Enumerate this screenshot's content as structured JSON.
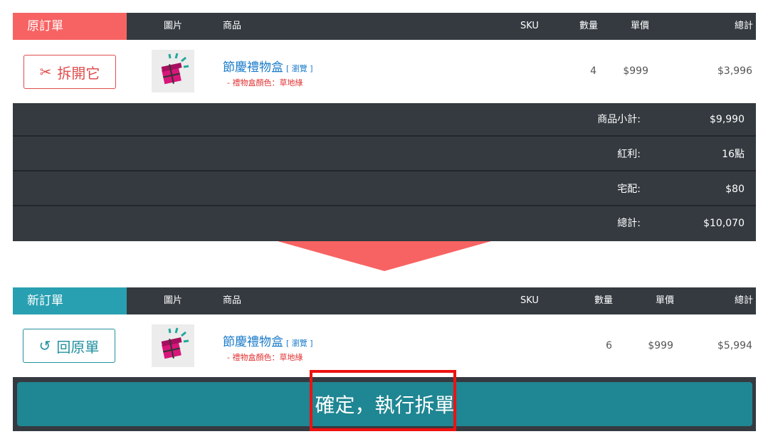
{
  "original_order": {
    "tag": "原訂單",
    "tag_color": "#f76363",
    "columns": {
      "image": "圖片",
      "product": "商品",
      "sku": "SKU",
      "qty": "數量",
      "unit_price": "單價",
      "total": "總計"
    },
    "action_label": "拆開它",
    "action_icon": "scissors-icon",
    "item": {
      "name": "節慶禮物盒",
      "browse": "[ 瀏覽 ]",
      "variant": "- 禮物盒顏色：草地綠",
      "sku": "",
      "qty": "4",
      "unit_price": "$999",
      "total": "$3,996"
    },
    "summary": [
      {
        "label": "商品小計:",
        "value": "$9,990"
      },
      {
        "label": "紅利:",
        "value": "16點"
      },
      {
        "label": "宅配:",
        "value": "$80"
      },
      {
        "label": "總計:",
        "value": "$10,070"
      }
    ]
  },
  "new_order": {
    "tag": "新訂單",
    "tag_color": "#28a0b1",
    "columns": {
      "image": "圖片",
      "product": "商品",
      "sku": "SKU",
      "qty": "數量",
      "unit_price": "單價",
      "total": "總計"
    },
    "action_label": "回原單",
    "action_icon": "undo-icon",
    "item": {
      "name": "節慶禮物盒",
      "browse": "[ 瀏覽 ]",
      "variant": "- 禮物盒顏色：草地綠",
      "sku": "",
      "qty": "6",
      "unit_price": "$999",
      "total": "$5,994"
    }
  },
  "confirm_label": "確定，執行拆單",
  "colors": {
    "header_bg": "#343a40",
    "arrow": "#f76363",
    "confirm_bg": "#1f8693",
    "link": "#1a7bc9",
    "variant": "#e03030"
  }
}
